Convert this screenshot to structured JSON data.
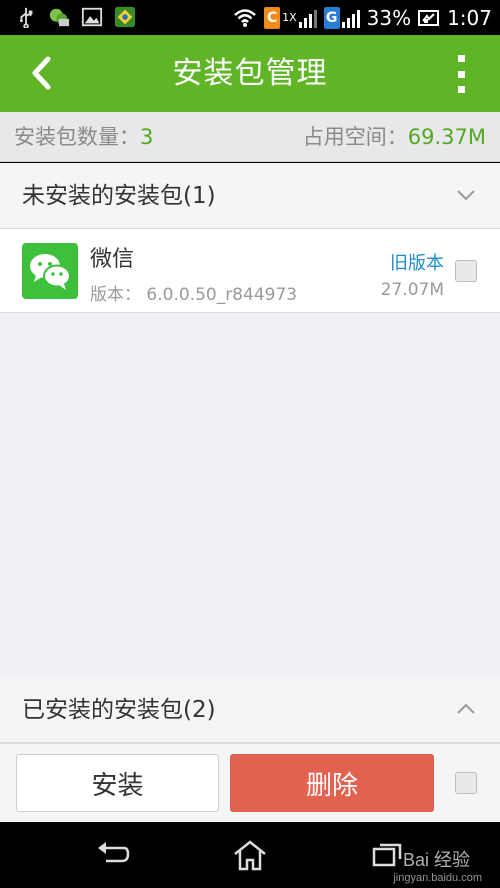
{
  "status_bar": {
    "battery_percent": "33%",
    "time": "1:07",
    "icons": [
      "usb-icon",
      "wechat-notification-icon",
      "gallery-icon",
      "app-notification-icon",
      "wifi-icon",
      "carrier-c-icon",
      "signal-icon",
      "carrier-g-icon",
      "signal-icon-2",
      "battery-icon"
    ],
    "carrier1": "C",
    "carrier1_extra": "1X",
    "carrier2": "G"
  },
  "header": {
    "title": "安装包管理",
    "back_icon": "chevron-left-icon",
    "more_icon": "more-vertical-icon",
    "bg_color": "#5fb526"
  },
  "summary": {
    "count_label": "安装包数量：",
    "count_value": "3",
    "space_label": "占用空间：",
    "space_value": "69.37M"
  },
  "sections": {
    "uninstalled": {
      "title": "未安装的安装包(1)",
      "expanded": true
    },
    "installed": {
      "title": "已安装的安装包(2)",
      "expanded": false
    }
  },
  "packages": [
    {
      "name": "微信",
      "version": "版本：  6.0.0.50_r844973",
      "tag": "旧版本",
      "size": "27.07M",
      "icon": "wechat-app-icon",
      "checked": false
    }
  ],
  "actions": {
    "install_label": "安装",
    "delete_label": "删除",
    "delete_color": "#e2614f"
  },
  "navbar": {
    "icons": [
      "back-nav-icon",
      "home-nav-icon",
      "recents-nav-icon"
    ],
    "watermark": "Bai 经验",
    "watermark_sub": "jingyan.baidu.com"
  }
}
